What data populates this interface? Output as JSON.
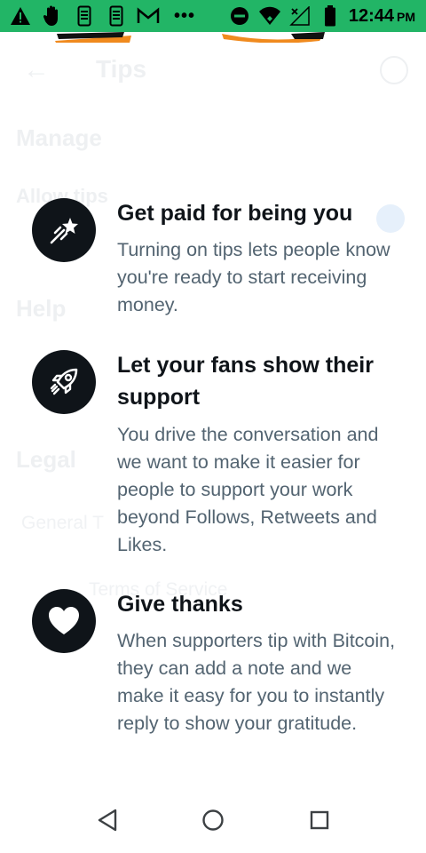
{
  "status_bar": {
    "time": "12:44",
    "ampm": "PM",
    "left_icons": [
      "warning-icon",
      "hand-icon",
      "phone-icon",
      "phone-icon",
      "gmail-icon"
    ],
    "more": "•••",
    "right_icons": [
      "do-not-disturb-icon",
      "wifi-icon",
      "signal-icon",
      "battery-icon"
    ]
  },
  "background_page": {
    "title": "Tips",
    "sections": {
      "manage": "Manage",
      "help": "Help",
      "legal": "Legal"
    },
    "items": {
      "allow_tips": "Allow tips",
      "general": "General T",
      "terms": "Terms of Service"
    }
  },
  "features": [
    {
      "icon": "shooting-star-icon",
      "title": "Get paid for being you",
      "body": "Turning on tips lets people know you're ready to start receiving money."
    },
    {
      "icon": "rocket-icon",
      "title": "Let your fans show their support",
      "body": "You drive the conversation and we want to make it easier for people to support your work beyond Follows, Retweets and Likes."
    },
    {
      "icon": "heart-icon",
      "title": "Give thanks",
      "body": "When supporters tip with Bitcoin, they can add a note and we make it easy for you to instantly reply to show your gratitude."
    }
  ],
  "nav_bar": {
    "back": "back-triangle-icon",
    "home": "home-circle-icon",
    "recents": "recents-square-icon"
  },
  "colors": {
    "status_bar": "#22b566",
    "icon_bg": "#0f1419",
    "title": "#0f1419",
    "body": "#536471"
  }
}
